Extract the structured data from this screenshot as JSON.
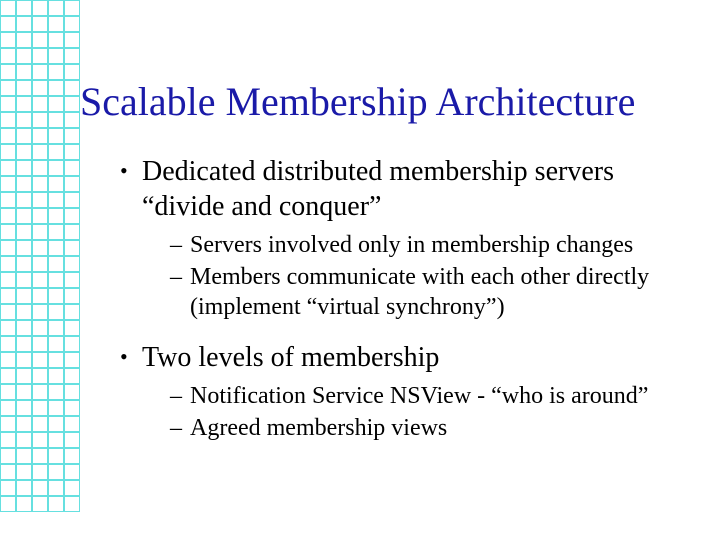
{
  "title": "Scalable Membership Architecture",
  "bullets": [
    {
      "text": "Dedicated distributed membership servers “divide and conquer”",
      "sub": [
        "Servers involved only in membership changes",
        "Members communicate with each other directly (implement “virtual synchrony”)"
      ]
    },
    {
      "text": "Two levels of membership",
      "sub": [
        "Notification Service NSView - “who is around”",
        "Agreed membership views"
      ]
    }
  ],
  "grid": {
    "rows": 32,
    "cols": 5
  }
}
